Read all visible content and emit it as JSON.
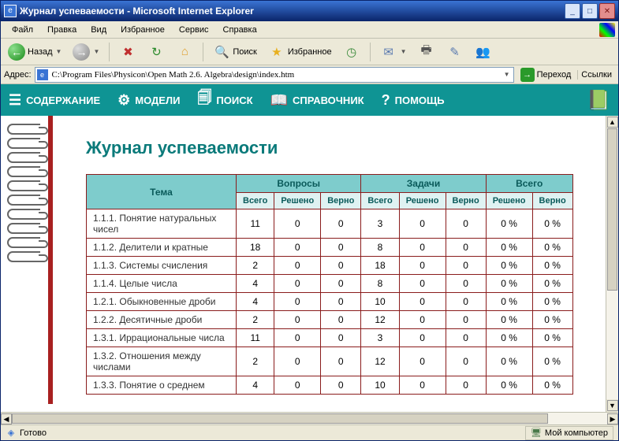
{
  "window": {
    "title": "Журнал успеваемости - Microsoft Internet Explorer"
  },
  "menu": {
    "items": [
      "Файл",
      "Правка",
      "Вид",
      "Избранное",
      "Сервис",
      "Справка"
    ]
  },
  "toolbar": {
    "back": "Назад",
    "search": "Поиск",
    "favorites": "Избранное"
  },
  "address": {
    "label": "Адрес:",
    "value": "C:\\Program Files\\Physicon\\Open Math 2.6. Algebra\\design\\index.htm",
    "go": "Переход",
    "links": "Ссылки"
  },
  "appnav": {
    "items": [
      {
        "icon": "list-icon",
        "label": "СОДЕРЖАНИЕ"
      },
      {
        "icon": "gear-icon",
        "label": "МОДЕЛИ"
      },
      {
        "icon": "search-icon",
        "label": "ПОИСК"
      },
      {
        "icon": "book-icon",
        "label": "СПРАВОЧНИК"
      },
      {
        "icon": "help-icon",
        "label": "ПОМОЩЬ"
      }
    ]
  },
  "page": {
    "title": "Журнал успеваемости",
    "headers": {
      "topic": "Тема",
      "q": "Вопросы",
      "t": "Задачи",
      "tot": "Всего",
      "total": "Всего",
      "solved": "Решено",
      "correct": "Верно"
    },
    "rows": [
      {
        "topic": "1.1.1. Понятие натуральных чисел",
        "qt": 11,
        "qs": 0,
        "qc": 0,
        "tt": 3,
        "ts": 0,
        "tc": 0,
        "gs": "0 %",
        "gc": "0 %"
      },
      {
        "topic": "1.1.2. Делители и кратные",
        "qt": 18,
        "qs": 0,
        "qc": 0,
        "tt": 8,
        "ts": 0,
        "tc": 0,
        "gs": "0 %",
        "gc": "0 %"
      },
      {
        "topic": "1.1.3. Системы счисления",
        "qt": 2,
        "qs": 0,
        "qc": 0,
        "tt": 18,
        "ts": 0,
        "tc": 0,
        "gs": "0 %",
        "gc": "0 %"
      },
      {
        "topic": "1.1.4. Целые числа",
        "qt": 4,
        "qs": 0,
        "qc": 0,
        "tt": 8,
        "ts": 0,
        "tc": 0,
        "gs": "0 %",
        "gc": "0 %"
      },
      {
        "topic": "1.2.1. Обыкновенные дроби",
        "qt": 4,
        "qs": 0,
        "qc": 0,
        "tt": 10,
        "ts": 0,
        "tc": 0,
        "gs": "0 %",
        "gc": "0 %"
      },
      {
        "topic": "1.2.2. Десятичные дроби",
        "qt": 2,
        "qs": 0,
        "qc": 0,
        "tt": 12,
        "ts": 0,
        "tc": 0,
        "gs": "0 %",
        "gc": "0 %"
      },
      {
        "topic": "1.3.1. Иррациональные числа",
        "qt": 11,
        "qs": 0,
        "qc": 0,
        "tt": 3,
        "ts": 0,
        "tc": 0,
        "gs": "0 %",
        "gc": "0 %"
      },
      {
        "topic": "1.3.2. Отношения между числами",
        "qt": 2,
        "qs": 0,
        "qc": 0,
        "tt": 12,
        "ts": 0,
        "tc": 0,
        "gs": "0 %",
        "gc": "0 %"
      },
      {
        "topic": "1.3.3. Понятие о среднем",
        "qt": 4,
        "qs": 0,
        "qc": 0,
        "tt": 10,
        "ts": 0,
        "tc": 0,
        "gs": "0 %",
        "gc": "0 %"
      }
    ]
  },
  "status": {
    "ready": "Готово",
    "zone": "Мой компьютер"
  }
}
